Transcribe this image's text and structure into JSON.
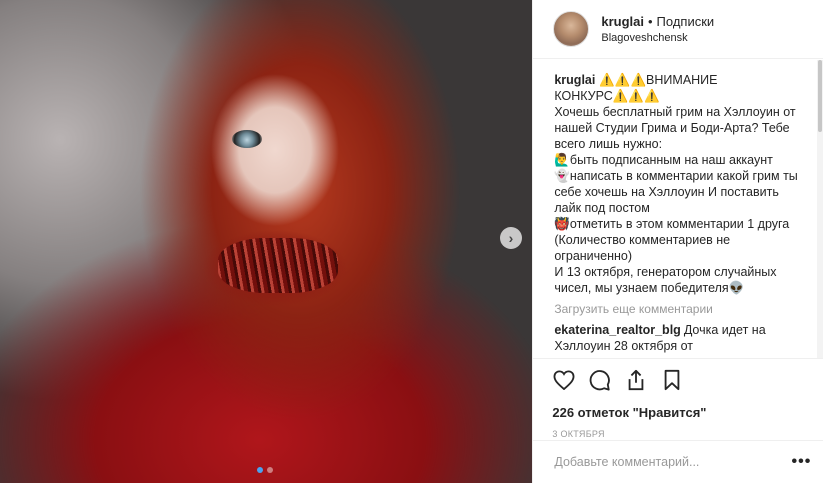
{
  "header": {
    "username": "kruglai",
    "separator": "•",
    "follow_label": "Подписки",
    "location": "Blagoveshchensk"
  },
  "caption": {
    "username": "kruglai",
    "text": "⚠️⚠️⚠️ВНИМАНИЕ КОНКУРС⚠️⚠️⚠️\nХочешь бесплатный грим на Хэллоуин от нашей Студии Грима и Боди-Арта? Тебе всего лишь нужно:\n🙋‍♂️быть подписанным на наш аккаунт\n👻написать в комментарии какой грим ты себе хочешь на Хэллоуин И поставить лайк под постом\n👹отметить в этом комментарии 1 друга (Количество комментариев не ограниченно)\nИ 13 октября, генератором случайных чисел, мы узнаем победителя👽"
  },
  "load_more_label": "Загрузить еще комментарии",
  "comments": [
    {
      "username": "ekaterina_realtor_blg",
      "text": "Дочка идет на Хэллоуин 28 октября от"
    }
  ],
  "likes_text": "226 отметок \"Нравится\"",
  "date": "3 ОКТЯБРЯ",
  "add_comment": {
    "placeholder": "Добавьте комментарий...",
    "more_label": "•••"
  },
  "media": {
    "next_label": "›",
    "dots": [
      true,
      false
    ]
  },
  "icons": {
    "like": "heart-icon",
    "comment": "comment-icon",
    "share": "share-icon",
    "save": "bookmark-icon"
  }
}
